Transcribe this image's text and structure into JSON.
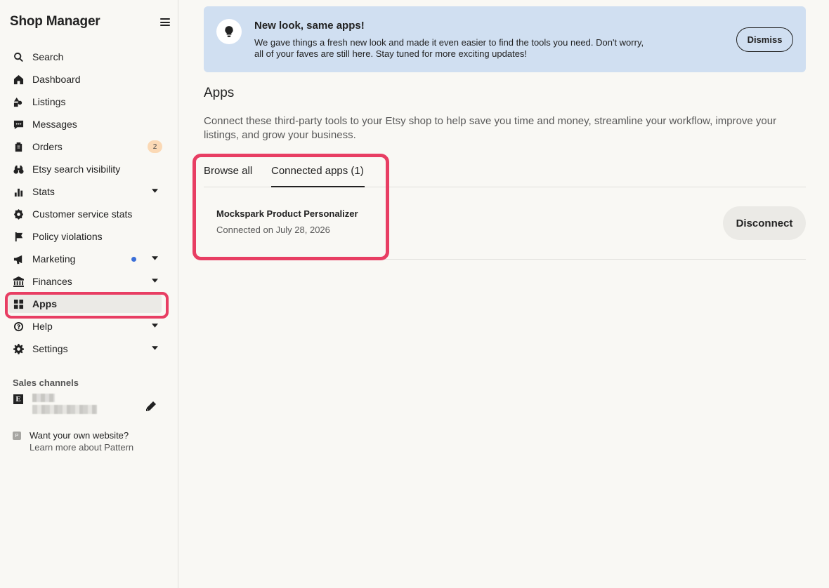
{
  "sidebar": {
    "title": "Shop Manager",
    "items": [
      {
        "label": "Search"
      },
      {
        "label": "Dashboard"
      },
      {
        "label": "Listings"
      },
      {
        "label": "Messages"
      },
      {
        "label": "Orders",
        "badge": "2"
      },
      {
        "label": "Etsy search visibility"
      },
      {
        "label": "Stats"
      },
      {
        "label": "Customer service stats"
      },
      {
        "label": "Policy violations"
      },
      {
        "label": "Marketing"
      },
      {
        "label": "Finances"
      },
      {
        "label": "Apps"
      },
      {
        "label": "Help"
      },
      {
        "label": "Settings"
      }
    ],
    "sales_channels": {
      "heading": "Sales channels",
      "etsy_letter": "E"
    },
    "pattern": {
      "icon_letter": "P",
      "question": "Want your own website?",
      "link": "Learn more about Pattern"
    }
  },
  "banner": {
    "title": "New look, same apps!",
    "text": "We gave things a fresh new look and made it even easier to find the tools you need. Don't worry, all of your faves are still here. Stay tuned for more exciting updates!",
    "dismiss_label": "Dismiss"
  },
  "main": {
    "title": "Apps",
    "description": "Connect these third-party tools to your Etsy shop to help save you time and money, streamline your workflow, improve your listings, and grow your business.",
    "tabs": [
      {
        "label": "Browse all"
      },
      {
        "label": "Connected apps (1)"
      }
    ],
    "connected_app": {
      "name": "Mockspark Product Personalizer",
      "date": "Connected on July 28, 2026",
      "disconnect_label": "Disconnect"
    }
  },
  "colors": {
    "highlight": "#e83e63",
    "banner_bg": "#d0dff1",
    "marketing_dot": "#3b6fd8",
    "badge_bg": "#fbd9b5"
  }
}
